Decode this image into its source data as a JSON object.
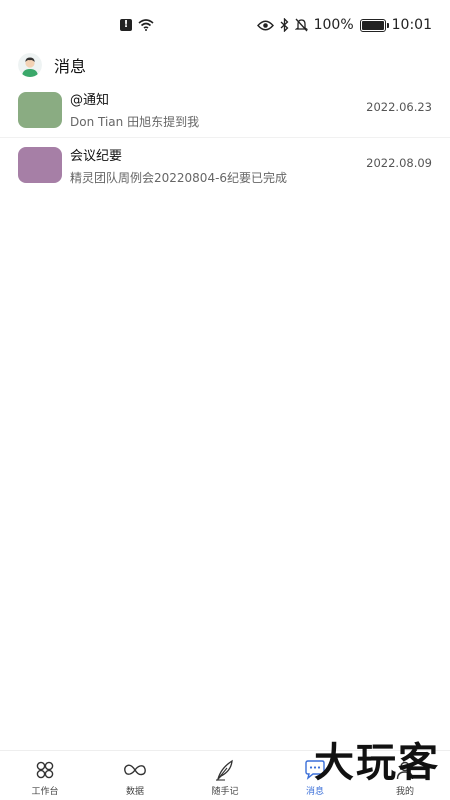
{
  "status_bar": {
    "battery_percent": "100%",
    "time": "10:01"
  },
  "header": {
    "title": "消息",
    "avatar_icon": "user-avatar-icon"
  },
  "messages": [
    {
      "title": "@通知",
      "subtitle": "Don Tian  田旭东提到我",
      "date": "2022.06.23",
      "thumb_color": "#8aac82"
    },
    {
      "title": "会议纪要",
      "subtitle": "精灵团队周例会20220804-6纪要已完成",
      "date": "2022.08.09",
      "thumb_color": "#a67fa6"
    }
  ],
  "bottom_nav": {
    "items": [
      {
        "label": "工作台",
        "icon": "grid-icon"
      },
      {
        "label": "数据",
        "icon": "infinity-icon"
      },
      {
        "label": "随手记",
        "icon": "feather-icon"
      },
      {
        "label": "消息",
        "icon": "chat-icon"
      },
      {
        "label": "我的",
        "icon": "profile-icon"
      }
    ],
    "active_index": 3,
    "active_color": "#3a6fd8"
  },
  "watermark": "大玩客"
}
